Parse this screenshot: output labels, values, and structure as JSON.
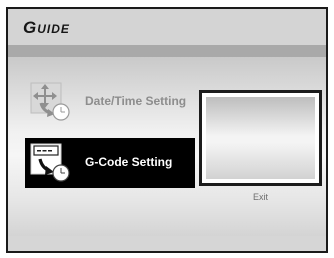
{
  "guide": {
    "title": "Guide",
    "menu": [
      {
        "label": "Date/Time Setting",
        "icon": "date-time-icon",
        "selected": false
      },
      {
        "label": "G-Code Setting",
        "icon": "g-code-icon",
        "selected": true
      }
    ],
    "exit_label": "Exit"
  },
  "colors": {
    "selected_bg": "#000000",
    "selected_text": "#ffffff",
    "unselected_text": "#8d8d8d",
    "title_band": "#a9a9a9"
  }
}
